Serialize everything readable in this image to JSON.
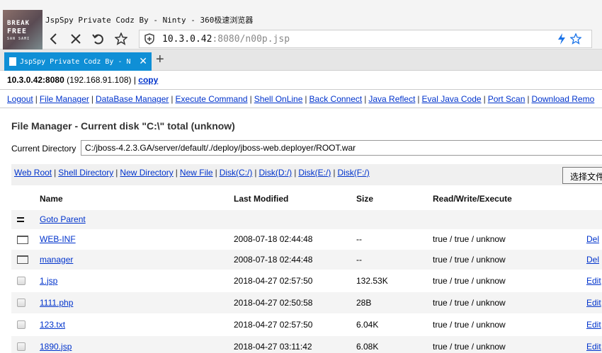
{
  "browser": {
    "window_title": "JspSpy Private Codz By - Ninty - 360极速浏览器",
    "logo_text": [
      "BREAK",
      "FREE",
      "SAN SAMI"
    ],
    "url_host": "10.3.0.42",
    "url_rest": ":8080/n00p.jsp",
    "tab_label": "JspSpy Private Codz By - N",
    "tab_close": "✕",
    "new_tab": "+"
  },
  "header": {
    "host": "10.3.0.42:8080",
    "ip": " (192.168.91.108) | ",
    "copy_label": "copy"
  },
  "menu": [
    "Logout",
    "File Manager",
    "DataBase Manager",
    "Execute Command",
    "Shell OnLine",
    "Back Connect",
    "Java Reflect",
    "Eval Java Code",
    "Port Scan",
    "Download Remo"
  ],
  "file_manager": {
    "title": "File Manager - Current disk \"C:\\\" total (unknow)",
    "current_dir_label": "Current Directory",
    "current_dir_value": "C:/jboss-4.2.3.GA/server/default/./deploy/jboss-web.deployer/ROOT.war",
    "quick_links": [
      "Web Root",
      "Shell Directory",
      "New Directory",
      "New File",
      "Disk(C:/)",
      "Disk(D:/)",
      "Disk(E:/)",
      "Disk(F:/)"
    ],
    "choose_file_button": "选择文件",
    "columns": [
      "Name",
      "Last Modified",
      "Size",
      "Read/Write/Execute"
    ],
    "goto_parent": "Goto Parent",
    "rows": [
      {
        "type": "folder",
        "name": "WEB-INF",
        "modified": "2008-07-18 02:44:48",
        "size": "--",
        "perm": "true / true / unknow",
        "action": "Del"
      },
      {
        "type": "folder",
        "name": "manager",
        "modified": "2008-07-18 02:44:48",
        "size": "--",
        "perm": "true / true / unknow",
        "action": "Del"
      },
      {
        "type": "file",
        "name": "1.jsp",
        "modified": "2018-04-27 02:57:50",
        "size": "132.53K",
        "perm": "true / true / unknow",
        "action": "Edit"
      },
      {
        "type": "file",
        "name": "1111.php",
        "modified": "2018-04-27 02:50:58",
        "size": "28B",
        "perm": "true / true / unknow",
        "action": "Edit"
      },
      {
        "type": "file",
        "name": "123.txt",
        "modified": "2018-04-27 02:57:50",
        "size": "6.04K",
        "perm": "true / true / unknow",
        "action": "Edit"
      },
      {
        "type": "file",
        "name": "1890.jsp",
        "modified": "2018-04-27 03:11:42",
        "size": "6.08K",
        "perm": "true / true / unknow",
        "action": "Edit"
      }
    ]
  },
  "colors": {
    "link": "#0033cc",
    "tab_active": "#0f8fd6",
    "row_shade": "#f4f4f4"
  }
}
